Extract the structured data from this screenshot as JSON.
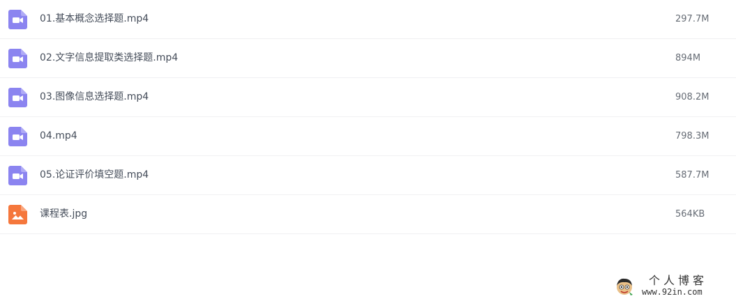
{
  "files": [
    {
      "name": "01.基本概念选择题.mp4",
      "size": "297.7M",
      "icon": "video-file-icon",
      "color": "#8b84f0"
    },
    {
      "name": "02.文字信息提取类选择题.mp4",
      "size": "894M",
      "icon": "video-file-icon",
      "color": "#8b84f0"
    },
    {
      "name": "03.图像信息选择题.mp4",
      "size": "908.2M",
      "icon": "video-file-icon",
      "color": "#8b84f0"
    },
    {
      "name": "04.mp4",
      "size": "798.3M",
      "icon": "video-file-icon",
      "color": "#8b84f0"
    },
    {
      "name": "05.论证评价填空题.mp4",
      "size": "587.7M",
      "icon": "video-file-icon",
      "color": "#8b84f0"
    },
    {
      "name": "课程表.jpg",
      "size": "564KB",
      "icon": "image-file-icon",
      "color": "#f5773c"
    }
  ],
  "watermark": {
    "title": "个人博客",
    "url": "www.92in.com",
    "icon": "cartoon-avatar-icon"
  }
}
